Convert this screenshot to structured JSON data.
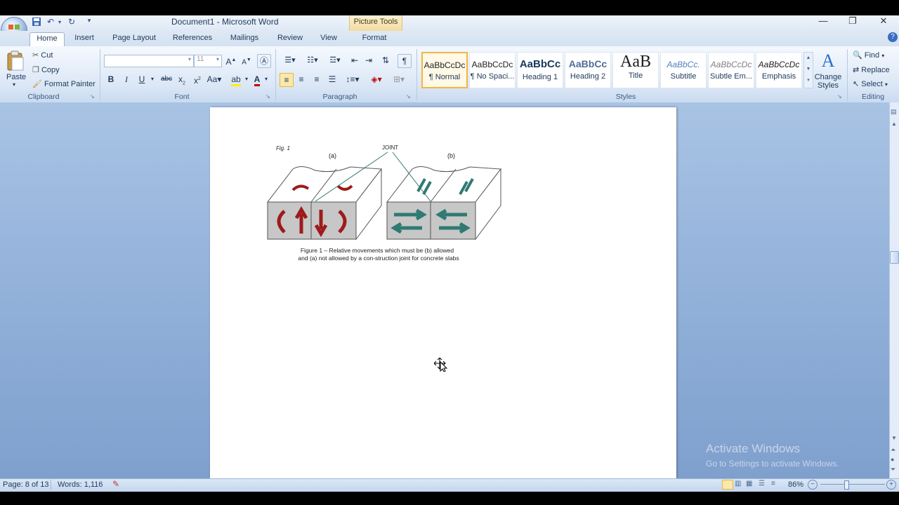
{
  "window": {
    "title": "Document1 - Microsoft Word",
    "context_tab": "Picture Tools"
  },
  "tabs": [
    "Home",
    "Insert",
    "Page Layout",
    "References",
    "Mailings",
    "Review",
    "View",
    "Format"
  ],
  "clipboard": {
    "paste": "Paste",
    "cut": "Cut",
    "copy": "Copy",
    "format_painter": "Format Painter",
    "label": "Clipboard"
  },
  "font": {
    "name_value": "",
    "size_value": "11",
    "label": "Font"
  },
  "paragraph": {
    "label": "Paragraph"
  },
  "styles": {
    "label": "Styles",
    "items": [
      {
        "sample": "AaBbCcDc",
        "name": "¶ Normal"
      },
      {
        "sample": "AaBbCcDc",
        "name": "¶ No Spaci..."
      },
      {
        "sample": "AaBbCc",
        "name": "Heading 1"
      },
      {
        "sample": "AaBbCc",
        "name": "Heading 2"
      },
      {
        "sample": "AaB",
        "name": "Title"
      },
      {
        "sample": "AaBbCc.",
        "name": "Subtitle"
      },
      {
        "sample": "AaBbCcDc",
        "name": "Subtle Em..."
      },
      {
        "sample": "AaBbCcDc",
        "name": "Emphasis"
      }
    ],
    "change_styles": "Change Styles"
  },
  "editing": {
    "find": "Find",
    "replace": "Replace",
    "select": "Select",
    "label": "Editing"
  },
  "figure": {
    "fig_label": "Fig. 1",
    "label_a": "(a)",
    "label_b": "(b)",
    "joint": "JOINT",
    "caption_line1": "Figure 1 – Relative movements which must be (b) allowed",
    "caption_line2": "and (a) not allowed by a con-struction joint for concrete slabs",
    "colors": {
      "red": "#9e1b1b",
      "teal": "#2f7a72",
      "gray_face": "#c7c7c7"
    }
  },
  "status": {
    "page": "Page: 8 of 13",
    "words": "Words: 1,116",
    "zoom": "86%"
  },
  "watermark": {
    "line1": "Activate Windows",
    "line2": "Go to Settings to activate Windows."
  }
}
